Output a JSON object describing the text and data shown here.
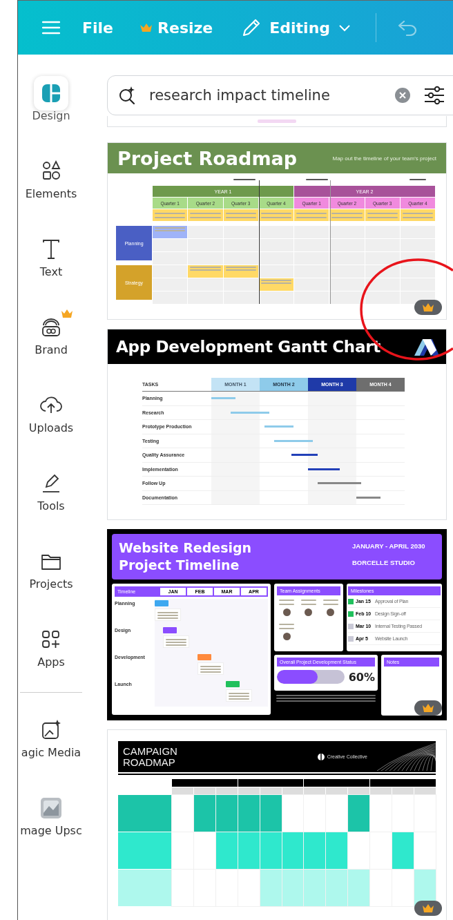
{
  "top_bar": {
    "file": "File",
    "resize": "Resize",
    "editing": "Editing"
  },
  "sidebar": {
    "items": [
      {
        "label": "Design",
        "selected": true,
        "premium": false
      },
      {
        "label": "Elements",
        "selected": false,
        "premium": false
      },
      {
        "label": "Text",
        "selected": false,
        "premium": false
      },
      {
        "label": "Brand",
        "selected": false,
        "premium": true
      },
      {
        "label": "Uploads",
        "selected": false,
        "premium": false
      },
      {
        "label": "Tools",
        "selected": false,
        "premium": false
      },
      {
        "label": "Projects",
        "selected": false,
        "premium": false
      },
      {
        "label": "Apps",
        "selected": false,
        "premium": false
      },
      {
        "label": "agic Media",
        "selected": false,
        "premium": false
      },
      {
        "label": "mage Upsc",
        "selected": false,
        "premium": false
      }
    ]
  },
  "search": {
    "value": "research impact timeline"
  },
  "templates": [
    {
      "kind": "partial",
      "premium": false
    },
    {
      "kind": "roadmap",
      "title": "Project Roadmap",
      "subtitle": "Map out the timeline of your team's project",
      "years": [
        "YEAR 1",
        "YEAR 2"
      ],
      "quarters": [
        "Quarter 1",
        "Quarter 2",
        "Quarter 3",
        "Quarter 4",
        "Quarter 1",
        "Quarter 2",
        "Quarter 3",
        "Quarter 4"
      ],
      "rows": [
        "Planning",
        "Strategy"
      ],
      "premium": true
    },
    {
      "kind": "gantt",
      "title": "App Development Gantt Chart",
      "tasks_header": "TASKS",
      "months": [
        "MONTH 1",
        "MONTH 2",
        "MONTH 3",
        "MONTH 4"
      ],
      "tasks": [
        "Planning",
        "Research",
        "Prototype Production",
        "Testing",
        "Quality Assurance",
        "Implementation",
        "Follow Up",
        "Documentation"
      ],
      "premium": false
    },
    {
      "kind": "website",
      "title": "Website Redesign Project Timeline",
      "dates": "JANUARY - APRIL 2030",
      "studio": "BORCELLE STUDIO",
      "timeline_header": "Timeline",
      "months": [
        "JAN",
        "FEB",
        "MAR",
        "APR"
      ],
      "phases": [
        "Planning",
        "Design",
        "Development",
        "Launch"
      ],
      "team_header": "Team Assignments",
      "milestones_header": "Milestones",
      "milestones": [
        {
          "date": "Jan 15",
          "label": "Approval of Plan",
          "checked": true
        },
        {
          "date": "Feb 10",
          "label": "Design Sign-off",
          "checked": true
        },
        {
          "date": "Mar 10",
          "label": "Internal Testing Passed",
          "checked": false
        },
        {
          "date": "Apr 5",
          "label": "Website Launch",
          "checked": false
        }
      ],
      "status_header": "Overall Project Development Status",
      "level": 0.6,
      "reading": "60%",
      "notes_header": "Notes",
      "premium": true
    },
    {
      "kind": "campaign",
      "title": "CAMPAIGN ROADMAP",
      "brand": "Creative Collective",
      "premium": true
    }
  ],
  "highlight_circle": true
}
